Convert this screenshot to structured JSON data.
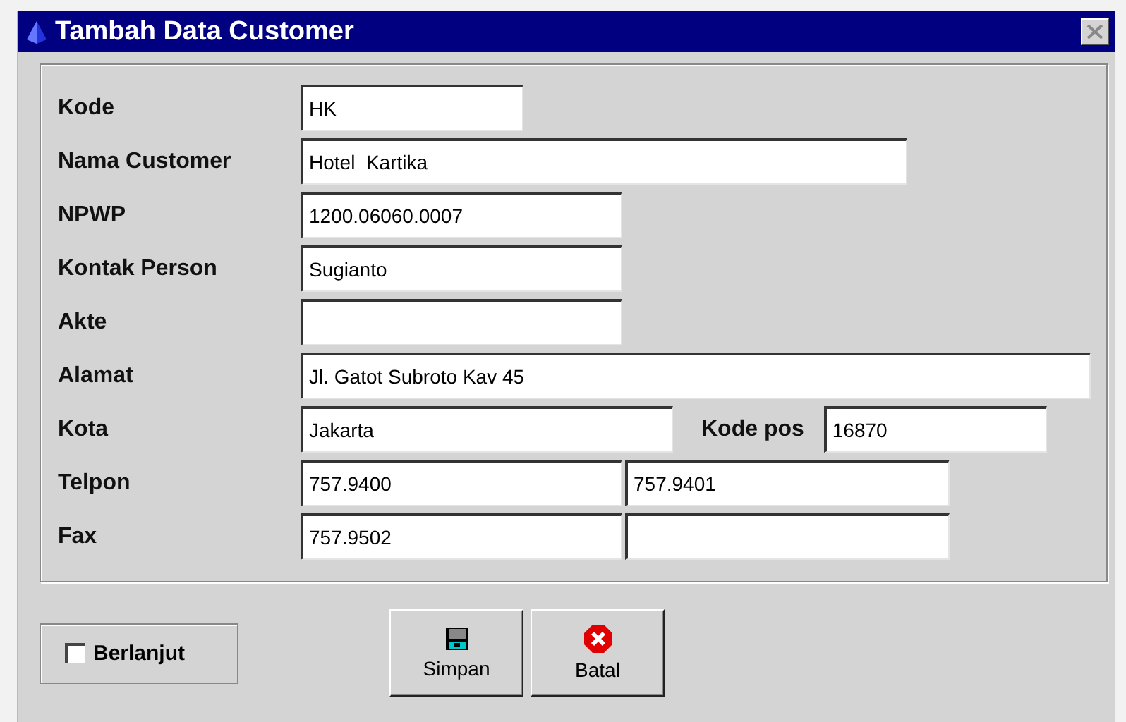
{
  "window": {
    "title": "Tambah Data Customer"
  },
  "rows": [
    {
      "label": "Kode",
      "kind": "single",
      "values": [
        "HK"
      ]
    },
    {
      "label": "Nama Customer",
      "kind": "single",
      "values": [
        "Hotel  Kartika"
      ]
    },
    {
      "label": "NPWP",
      "kind": "single",
      "values": [
        "1200.06060.0007"
      ]
    },
    {
      "label": "Kontak Person",
      "kind": "single",
      "values": [
        "Sugianto"
      ]
    },
    {
      "label": "Akte",
      "kind": "single"
    },
    {
      "label": "Alamat",
      "kind": "single",
      "values": [
        "Jl. Gatot Subroto Kav 45"
      ]
    },
    {
      "label": "Kota",
      "kind": "labeled_pair",
      "values": [
        "Jakarta",
        "16870"
      ],
      "second_label": "Kode pos"
    },
    {
      "label": "Telpon",
      "kind": "pair",
      "values": [
        "757.9400",
        "757.9401"
      ]
    },
    {
      "label": "Fax",
      "kind": "pair",
      "values": [
        "757.9502"
      ]
    }
  ],
  "continue_option": {
    "label": "Berlanjut",
    "checked": false
  },
  "buttons": [
    {
      "label": "Simpan",
      "kind": "save"
    },
    {
      "label": "Batal",
      "kind": "cancel"
    }
  ]
}
